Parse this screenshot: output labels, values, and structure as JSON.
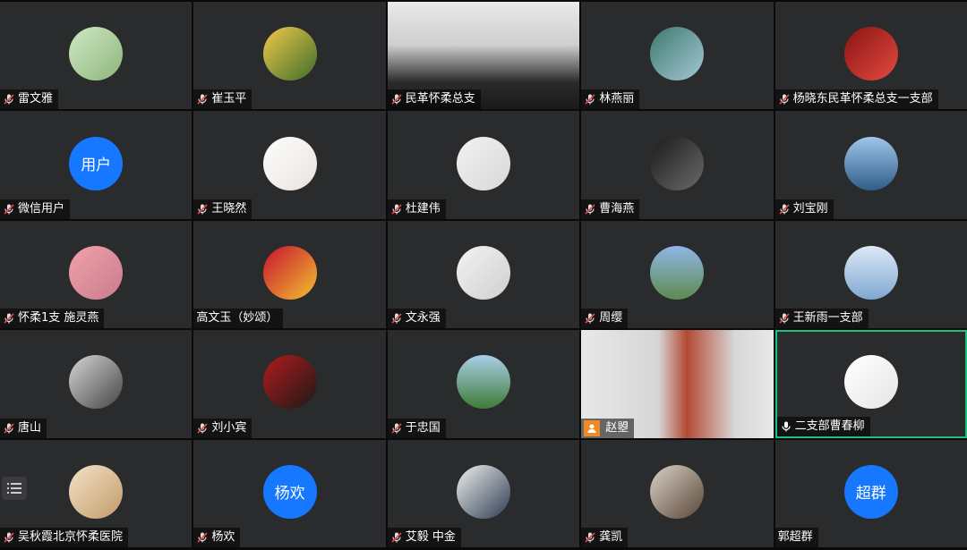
{
  "participants": [
    {
      "name": "雷文雅",
      "avatar": "photo-road",
      "mic": "muted"
    },
    {
      "name": "崔玉平",
      "avatar": "photo-woman-sunglasses",
      "mic": "muted"
    },
    {
      "name": "民革怀柔总支",
      "avatar": "video-meeting-room",
      "mic": "muted"
    },
    {
      "name": "林燕丽",
      "avatar": "photo-lake",
      "mic": "muted"
    },
    {
      "name": "杨晓东民革怀柔总支一支部",
      "avatar": "photo-red-stage",
      "mic": "muted"
    },
    {
      "name": "微信用户",
      "avatar_text": "用户",
      "mic": "muted"
    },
    {
      "name": "王晓然",
      "avatar": "photo-flower-sketch",
      "mic": "muted"
    },
    {
      "name": "杜建伟",
      "avatar": "photo-cartoon-man",
      "mic": "muted"
    },
    {
      "name": "曹海燕",
      "avatar": "photo-tunnel",
      "mic": "muted"
    },
    {
      "name": "刘宝刚",
      "avatar": "photo-lake-blue",
      "mic": "muted"
    },
    {
      "name": "怀柔1支 施灵燕",
      "avatar": "photo-pink-flowers",
      "mic": "muted"
    },
    {
      "name": "高文玉（妙颂）",
      "avatar": "photo-emblem",
      "mic": "none"
    },
    {
      "name": "文永强",
      "avatar": "photo-couple",
      "mic": "muted"
    },
    {
      "name": "周缨",
      "avatar": "photo-mountains",
      "mic": "muted"
    },
    {
      "name": "王新雨一支部",
      "avatar": "photo-boat",
      "mic": "muted"
    },
    {
      "name": "唐山",
      "avatar": "photo-helmet",
      "mic": "muted"
    },
    {
      "name": "刘小宾",
      "avatar": "photo-athlete",
      "mic": "muted"
    },
    {
      "name": "于忠国",
      "avatar": "photo-green-field",
      "mic": "muted"
    },
    {
      "name": "赵曌",
      "avatar": "video-woman",
      "mic": "camera"
    },
    {
      "name": "二支部曹春柳",
      "avatar": "photo-cartoon-girl",
      "mic": "on",
      "active": true
    },
    {
      "name": "吴秋霞北京怀柔医院",
      "avatar": "photo-smiling-woman",
      "mic": "muted"
    },
    {
      "name": "杨欢",
      "avatar_text": "杨欢",
      "mic": "muted"
    },
    {
      "name": "艾毅 中金",
      "avatar": "photo-man-suit",
      "mic": "muted"
    },
    {
      "name": "龚凯",
      "avatar": "photo-wine",
      "mic": "muted"
    },
    {
      "name": "郭超群",
      "avatar_text": "超群",
      "mic": "none"
    }
  ],
  "colors": {
    "tile": "#2a2b2d",
    "accent_border": "#19c37d",
    "text_avatar": "#1677ff",
    "muted_mic": "#e5484d"
  }
}
